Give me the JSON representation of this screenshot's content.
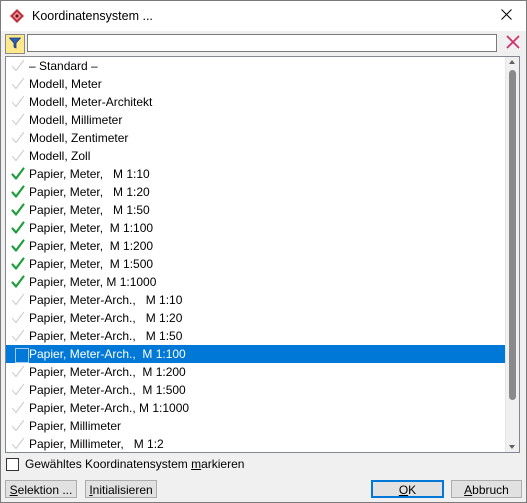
{
  "window": {
    "title": "Koordinatensystem ...",
    "close_symbol": "✕"
  },
  "filter": {
    "value": "",
    "icon": "filter-funnel-icon",
    "clear_icon": "clear-x-icon"
  },
  "list": {
    "items": [
      {
        "label": "– Standard –",
        "checked": false,
        "selected": false
      },
      {
        "label": "Modell, Meter",
        "checked": false,
        "selected": false
      },
      {
        "label": "Modell, Meter-Architekt",
        "checked": false,
        "selected": false
      },
      {
        "label": "Modell, Millimeter",
        "checked": false,
        "selected": false
      },
      {
        "label": "Modell, Zentimeter",
        "checked": false,
        "selected": false
      },
      {
        "label": "Modell, Zoll",
        "checked": false,
        "selected": false
      },
      {
        "label": "Papier, Meter,   M 1:10",
        "checked": true,
        "selected": false
      },
      {
        "label": "Papier, Meter,   M 1:20",
        "checked": true,
        "selected": false
      },
      {
        "label": "Papier, Meter,   M 1:50",
        "checked": true,
        "selected": false
      },
      {
        "label": "Papier, Meter,  M 1:100",
        "checked": true,
        "selected": false
      },
      {
        "label": "Papier, Meter,  M 1:200",
        "checked": true,
        "selected": false
      },
      {
        "label": "Papier, Meter,  M 1:500",
        "checked": true,
        "selected": false
      },
      {
        "label": "Papier, Meter, M 1:1000",
        "checked": true,
        "selected": false
      },
      {
        "label": "Papier, Meter-Arch.,   M 1:10",
        "checked": false,
        "selected": false
      },
      {
        "label": "Papier, Meter-Arch.,   M 1:20",
        "checked": false,
        "selected": false
      },
      {
        "label": "Papier, Meter-Arch.,   M 1:50",
        "checked": false,
        "selected": false
      },
      {
        "label": "Papier, Meter-Arch.,  M 1:100",
        "checked": false,
        "selected": true
      },
      {
        "label": "Papier, Meter-Arch.,  M 1:200",
        "checked": false,
        "selected": false
      },
      {
        "label": "Papier, Meter-Arch.,  M 1:500",
        "checked": false,
        "selected": false
      },
      {
        "label": "Papier, Meter-Arch., M 1:1000",
        "checked": false,
        "selected": false
      },
      {
        "label": "Papier, Millimeter",
        "checked": false,
        "selected": false
      },
      {
        "label": "Papier, Millimeter,   M 1:2",
        "checked": false,
        "selected": false
      }
    ]
  },
  "options": {
    "mark_selected_before": "Gewähltes Koordinatensystem ",
    "mark_selected_underlined": "m",
    "mark_selected_after": "arkieren",
    "mark_selected_checked": false
  },
  "buttons": {
    "selection_underlined": "S",
    "selection_rest": "elektion ...",
    "initialize_underlined": "I",
    "initialize_rest": "nitialisieren",
    "ok_underlined": "O",
    "ok_rest": "K",
    "cancel_underlined": "A",
    "cancel_rest": "bbruch"
  },
  "colors": {
    "check_active": "#1e9e3e",
    "check_inactive": "#cfcfcf",
    "selection": "#0078d7"
  }
}
